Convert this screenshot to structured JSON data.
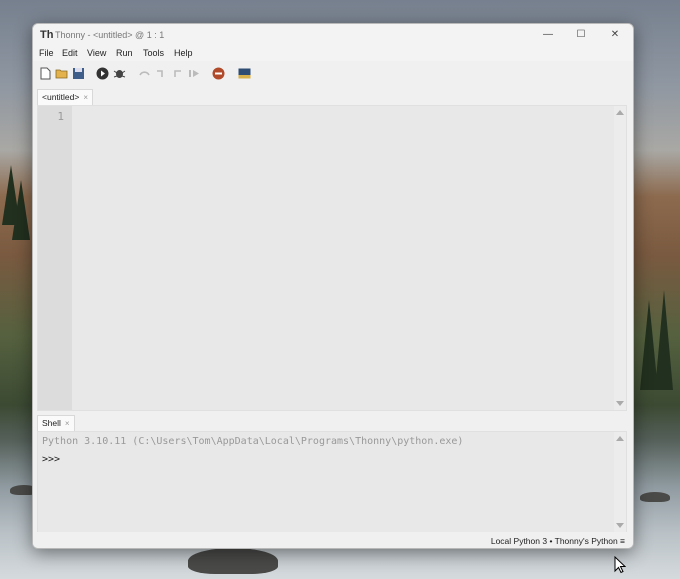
{
  "window": {
    "title": "Thonny  -  <untitled>  @  1 : 1",
    "controls": {
      "minimize": "—",
      "maximize": "☐",
      "close": "✕"
    }
  },
  "menu": [
    "File",
    "Edit",
    "View",
    "Run",
    "Tools",
    "Help"
  ],
  "toolbar": {
    "icons": [
      "new-file-icon",
      "open-file-icon",
      "save-icon",
      "run-icon",
      "debug-icon",
      "step-over-icon",
      "step-into-icon",
      "step-out-icon",
      "resume-icon",
      "stop-icon",
      "zoom-icon"
    ]
  },
  "editor": {
    "tab_label": "<untitled>",
    "tab_close": "×",
    "line_number": "1",
    "content": ""
  },
  "shell": {
    "tab_label": "Shell",
    "tab_close": "×",
    "banner": "Python 3.10.11 (C:\\Users\\Tom\\AppData\\Local\\Programs\\Thonny\\python.exe)",
    "prompt": ">>>"
  },
  "status": {
    "interpreter": "Local Python 3  •  Thonny's Python  ≡"
  },
  "colors": {
    "stop_button": "#b04a2a",
    "editor_bg": "#e8e8e8",
    "gutter_bg": "#dcdcdc"
  }
}
